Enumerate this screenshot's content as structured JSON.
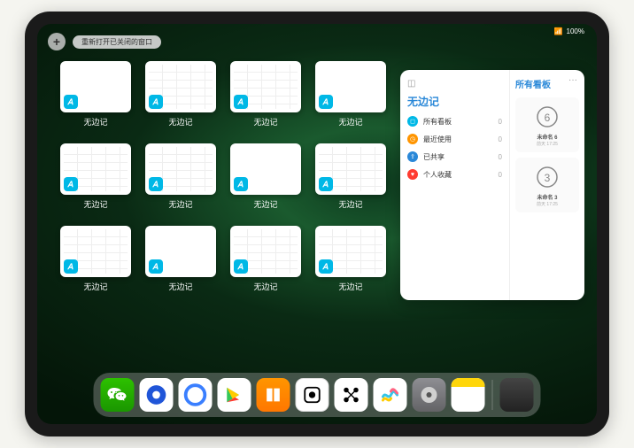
{
  "status": {
    "signal": "•••",
    "battery": "100%"
  },
  "topBar": {
    "addLabel": "+",
    "reopenLabel": "重新打开已关闭的窗口"
  },
  "thumbnails": {
    "appLabel": "无边记",
    "items": [
      {
        "variant": "blank"
      },
      {
        "variant": "calendar"
      },
      {
        "variant": "calendar"
      },
      {
        "variant": "blank"
      },
      {
        "variant": "calendar"
      },
      {
        "variant": "calendar"
      },
      {
        "variant": "blank"
      },
      {
        "variant": "calendar"
      },
      {
        "variant": "calendar"
      },
      {
        "variant": "blank"
      },
      {
        "variant": "calendar"
      },
      {
        "variant": "calendar"
      }
    ]
  },
  "panel": {
    "leftTitle": "无边记",
    "rightTitle": "所有看板",
    "more": "···",
    "rows": [
      {
        "label": "所有看板",
        "count": "0",
        "color": "#00b8e6",
        "icon": "◻"
      },
      {
        "label": "最近使用",
        "count": "0",
        "color": "#ff9500",
        "icon": "◷"
      },
      {
        "label": "已共享",
        "count": "0",
        "color": "#2a88d8",
        "icon": "⇪"
      },
      {
        "label": "个人收藏",
        "count": "0",
        "color": "#ff3b30",
        "icon": "♥"
      }
    ],
    "boards": [
      {
        "name": "未命名 6",
        "date": "前天 17:25",
        "sketch": "6"
      },
      {
        "name": "未命名 3",
        "date": "前天 17:25",
        "sketch": "3"
      }
    ]
  },
  "dock": {
    "icons": [
      {
        "name": "wechat-icon",
        "class": "di-wechat"
      },
      {
        "name": "tencent-video-icon",
        "class": "di-tencent"
      },
      {
        "name": "quark-icon",
        "class": "di-quark"
      },
      {
        "name": "aliyun-icon",
        "class": "di-play"
      },
      {
        "name": "books-icon",
        "class": "di-books"
      },
      {
        "name": "dice-app-icon",
        "class": "di-dice"
      },
      {
        "name": "connect-icon",
        "class": "di-connect"
      },
      {
        "name": "freeform-icon",
        "class": "di-freeform"
      },
      {
        "name": "settings-icon",
        "class": "di-settings"
      },
      {
        "name": "notes-icon",
        "class": "di-notes"
      }
    ],
    "recentAppsName": "app-library-icon"
  }
}
